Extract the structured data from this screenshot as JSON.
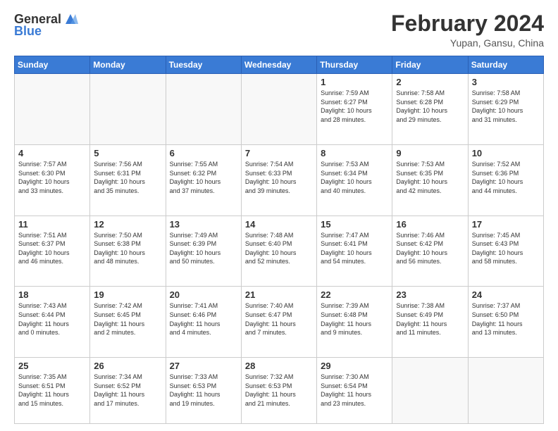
{
  "header": {
    "logo_general": "General",
    "logo_blue": "Blue",
    "month_year": "February 2024",
    "location": "Yupan, Gansu, China"
  },
  "days_of_week": [
    "Sunday",
    "Monday",
    "Tuesday",
    "Wednesday",
    "Thursday",
    "Friday",
    "Saturday"
  ],
  "weeks": [
    [
      {
        "day": "",
        "info": ""
      },
      {
        "day": "",
        "info": ""
      },
      {
        "day": "",
        "info": ""
      },
      {
        "day": "",
        "info": ""
      },
      {
        "day": "1",
        "info": "Sunrise: 7:59 AM\nSunset: 6:27 PM\nDaylight: 10 hours\nand 28 minutes."
      },
      {
        "day": "2",
        "info": "Sunrise: 7:58 AM\nSunset: 6:28 PM\nDaylight: 10 hours\nand 29 minutes."
      },
      {
        "day": "3",
        "info": "Sunrise: 7:58 AM\nSunset: 6:29 PM\nDaylight: 10 hours\nand 31 minutes."
      }
    ],
    [
      {
        "day": "4",
        "info": "Sunrise: 7:57 AM\nSunset: 6:30 PM\nDaylight: 10 hours\nand 33 minutes."
      },
      {
        "day": "5",
        "info": "Sunrise: 7:56 AM\nSunset: 6:31 PM\nDaylight: 10 hours\nand 35 minutes."
      },
      {
        "day": "6",
        "info": "Sunrise: 7:55 AM\nSunset: 6:32 PM\nDaylight: 10 hours\nand 37 minutes."
      },
      {
        "day": "7",
        "info": "Sunrise: 7:54 AM\nSunset: 6:33 PM\nDaylight: 10 hours\nand 39 minutes."
      },
      {
        "day": "8",
        "info": "Sunrise: 7:53 AM\nSunset: 6:34 PM\nDaylight: 10 hours\nand 40 minutes."
      },
      {
        "day": "9",
        "info": "Sunrise: 7:53 AM\nSunset: 6:35 PM\nDaylight: 10 hours\nand 42 minutes."
      },
      {
        "day": "10",
        "info": "Sunrise: 7:52 AM\nSunset: 6:36 PM\nDaylight: 10 hours\nand 44 minutes."
      }
    ],
    [
      {
        "day": "11",
        "info": "Sunrise: 7:51 AM\nSunset: 6:37 PM\nDaylight: 10 hours\nand 46 minutes."
      },
      {
        "day": "12",
        "info": "Sunrise: 7:50 AM\nSunset: 6:38 PM\nDaylight: 10 hours\nand 48 minutes."
      },
      {
        "day": "13",
        "info": "Sunrise: 7:49 AM\nSunset: 6:39 PM\nDaylight: 10 hours\nand 50 minutes."
      },
      {
        "day": "14",
        "info": "Sunrise: 7:48 AM\nSunset: 6:40 PM\nDaylight: 10 hours\nand 52 minutes."
      },
      {
        "day": "15",
        "info": "Sunrise: 7:47 AM\nSunset: 6:41 PM\nDaylight: 10 hours\nand 54 minutes."
      },
      {
        "day": "16",
        "info": "Sunrise: 7:46 AM\nSunset: 6:42 PM\nDaylight: 10 hours\nand 56 minutes."
      },
      {
        "day": "17",
        "info": "Sunrise: 7:45 AM\nSunset: 6:43 PM\nDaylight: 10 hours\nand 58 minutes."
      }
    ],
    [
      {
        "day": "18",
        "info": "Sunrise: 7:43 AM\nSunset: 6:44 PM\nDaylight: 11 hours\nand 0 minutes."
      },
      {
        "day": "19",
        "info": "Sunrise: 7:42 AM\nSunset: 6:45 PM\nDaylight: 11 hours\nand 2 minutes."
      },
      {
        "day": "20",
        "info": "Sunrise: 7:41 AM\nSunset: 6:46 PM\nDaylight: 11 hours\nand 4 minutes."
      },
      {
        "day": "21",
        "info": "Sunrise: 7:40 AM\nSunset: 6:47 PM\nDaylight: 11 hours\nand 7 minutes."
      },
      {
        "day": "22",
        "info": "Sunrise: 7:39 AM\nSunset: 6:48 PM\nDaylight: 11 hours\nand 9 minutes."
      },
      {
        "day": "23",
        "info": "Sunrise: 7:38 AM\nSunset: 6:49 PM\nDaylight: 11 hours\nand 11 minutes."
      },
      {
        "day": "24",
        "info": "Sunrise: 7:37 AM\nSunset: 6:50 PM\nDaylight: 11 hours\nand 13 minutes."
      }
    ],
    [
      {
        "day": "25",
        "info": "Sunrise: 7:35 AM\nSunset: 6:51 PM\nDaylight: 11 hours\nand 15 minutes."
      },
      {
        "day": "26",
        "info": "Sunrise: 7:34 AM\nSunset: 6:52 PM\nDaylight: 11 hours\nand 17 minutes."
      },
      {
        "day": "27",
        "info": "Sunrise: 7:33 AM\nSunset: 6:53 PM\nDaylight: 11 hours\nand 19 minutes."
      },
      {
        "day": "28",
        "info": "Sunrise: 7:32 AM\nSunset: 6:53 PM\nDaylight: 11 hours\nand 21 minutes."
      },
      {
        "day": "29",
        "info": "Sunrise: 7:30 AM\nSunset: 6:54 PM\nDaylight: 11 hours\nand 23 minutes."
      },
      {
        "day": "",
        "info": ""
      },
      {
        "day": "",
        "info": ""
      }
    ]
  ]
}
